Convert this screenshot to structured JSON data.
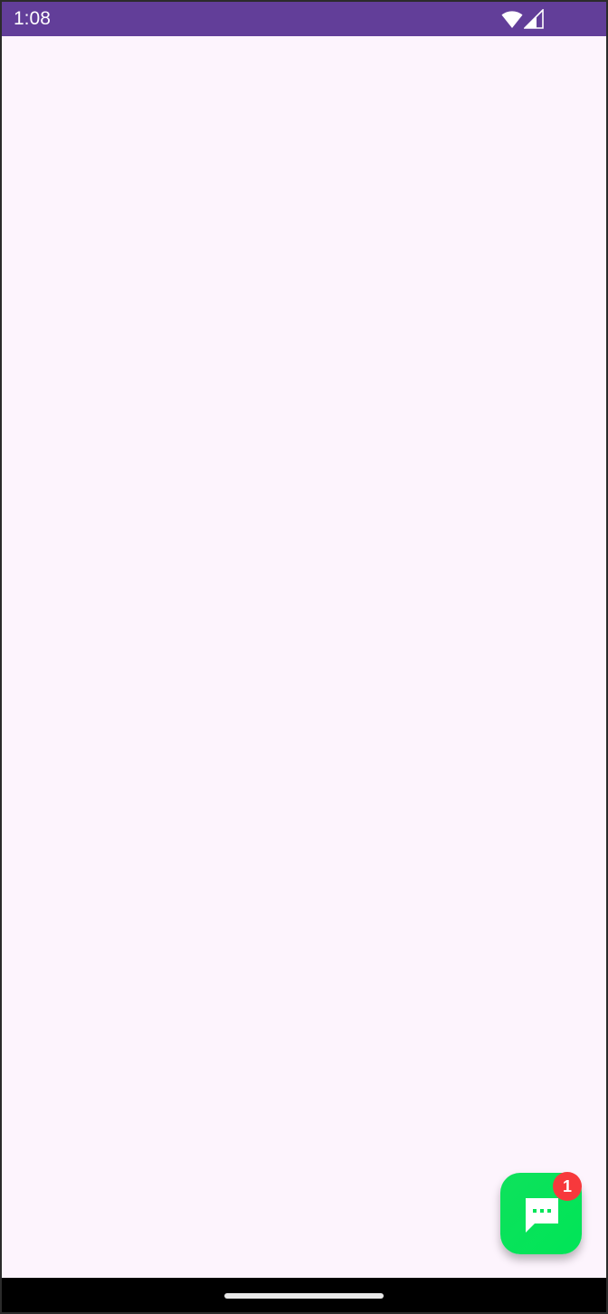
{
  "status_bar": {
    "time": "1:08",
    "icons": [
      "wifi-icon",
      "cellular-signal-icon"
    ],
    "background_color": "#623e99"
  },
  "content": {
    "background_color": "#fdf4fd"
  },
  "chat_fab": {
    "icon": "chat-bubble-icon",
    "badge_count": "1",
    "color": "#00e557",
    "badge_color": "#f7393c"
  },
  "navigation_bar": {
    "background_color": "#000000",
    "handle": "home-gesture-handle"
  }
}
